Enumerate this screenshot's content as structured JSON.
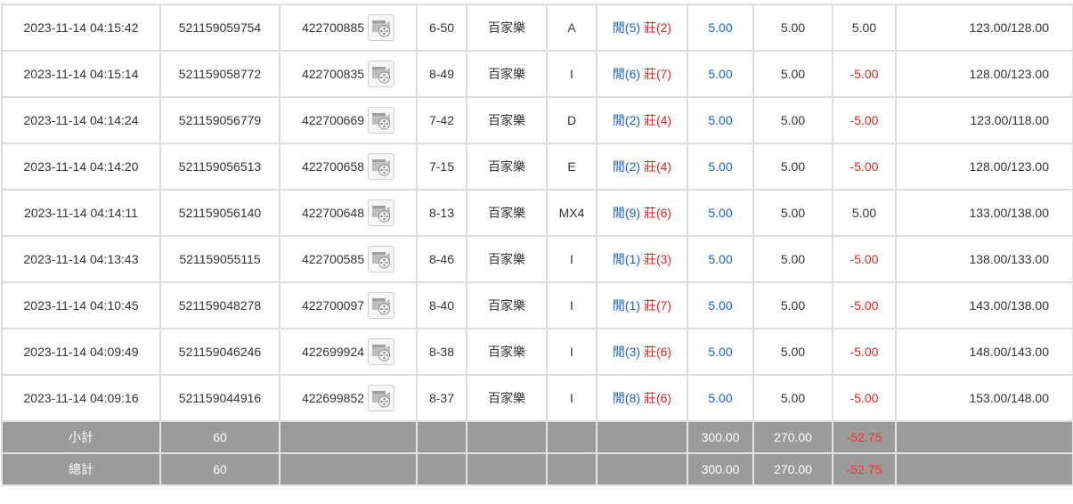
{
  "colors": {
    "player": "#1a5fc8",
    "banker": "#e02020",
    "negative": "#e02020",
    "summary_bg": "#9b9b9b"
  },
  "rows": [
    {
      "time": "2023-11-14 04:15:42",
      "bet_id": "521159059754",
      "round_id": "422700885",
      "shoe": "6-50",
      "game": "百家樂",
      "table": "A",
      "p_label": "閒",
      "p_score": "(5)",
      "b_label": "莊",
      "b_score": "(2)",
      "bet": "5.00",
      "valid": "5.00",
      "win": "5.00",
      "win_neg": false,
      "balance": "123.00/128.00"
    },
    {
      "time": "2023-11-14 04:15:14",
      "bet_id": "521159058772",
      "round_id": "422700835",
      "shoe": "8-49",
      "game": "百家樂",
      "table": "I",
      "p_label": "閒",
      "p_score": "(6)",
      "b_label": "莊",
      "b_score": "(7)",
      "bet": "5.00",
      "valid": "5.00",
      "win": "-5.00",
      "win_neg": true,
      "balance": "128.00/123.00"
    },
    {
      "time": "2023-11-14 04:14:24",
      "bet_id": "521159056779",
      "round_id": "422700669",
      "shoe": "7-42",
      "game": "百家樂",
      "table": "D",
      "p_label": "閒",
      "p_score": "(2)",
      "b_label": "莊",
      "b_score": "(4)",
      "bet": "5.00",
      "valid": "5.00",
      "win": "-5.00",
      "win_neg": true,
      "balance": "123.00/118.00"
    },
    {
      "time": "2023-11-14 04:14:20",
      "bet_id": "521159056513",
      "round_id": "422700658",
      "shoe": "7-15",
      "game": "百家樂",
      "table": "E",
      "p_label": "閒",
      "p_score": "(2)",
      "b_label": "莊",
      "b_score": "(4)",
      "bet": "5.00",
      "valid": "5.00",
      "win": "-5.00",
      "win_neg": true,
      "balance": "128.00/123.00"
    },
    {
      "time": "2023-11-14 04:14:11",
      "bet_id": "521159056140",
      "round_id": "422700648",
      "shoe": "8-13",
      "game": "百家樂",
      "table": "MX4",
      "p_label": "閒",
      "p_score": "(9)",
      "b_label": "莊",
      "b_score": "(6)",
      "bet": "5.00",
      "valid": "5.00",
      "win": "5.00",
      "win_neg": false,
      "balance": "133.00/138.00"
    },
    {
      "time": "2023-11-14 04:13:43",
      "bet_id": "521159055115",
      "round_id": "422700585",
      "shoe": "8-46",
      "game": "百家樂",
      "table": "I",
      "p_label": "閒",
      "p_score": "(1)",
      "b_label": "莊",
      "b_score": "(3)",
      "bet": "5.00",
      "valid": "5.00",
      "win": "-5.00",
      "win_neg": true,
      "balance": "138.00/133.00"
    },
    {
      "time": "2023-11-14 04:10:45",
      "bet_id": "521159048278",
      "round_id": "422700097",
      "shoe": "8-40",
      "game": "百家樂",
      "table": "I",
      "p_label": "閒",
      "p_score": "(1)",
      "b_label": "莊",
      "b_score": "(7)",
      "bet": "5.00",
      "valid": "5.00",
      "win": "-5.00",
      "win_neg": true,
      "balance": "143.00/138.00"
    },
    {
      "time": "2023-11-14 04:09:49",
      "bet_id": "521159046246",
      "round_id": "422699924",
      "shoe": "8-38",
      "game": "百家樂",
      "table": "I",
      "p_label": "閒",
      "p_score": "(3)",
      "b_label": "莊",
      "b_score": "(6)",
      "bet": "5.00",
      "valid": "5.00",
      "win": "-5.00",
      "win_neg": true,
      "balance": "148.00/143.00"
    },
    {
      "time": "2023-11-14 04:09:16",
      "bet_id": "521159044916",
      "round_id": "422699852",
      "shoe": "8-37",
      "game": "百家樂",
      "table": "I",
      "p_label": "閒",
      "p_score": "(8)",
      "b_label": "莊",
      "b_score": "(6)",
      "bet": "5.00",
      "valid": "5.00",
      "win": "-5.00",
      "win_neg": true,
      "balance": "153.00/148.00"
    }
  ],
  "subtotal": {
    "label": "小計",
    "count": "60",
    "bet": "300.00",
    "valid": "270.00",
    "win": "-52.75"
  },
  "total": {
    "label": "總計",
    "count": "60",
    "bet": "300.00",
    "valid": "270.00",
    "win": "-52.75"
  },
  "icons": {
    "replay": "film-reel-icon"
  }
}
